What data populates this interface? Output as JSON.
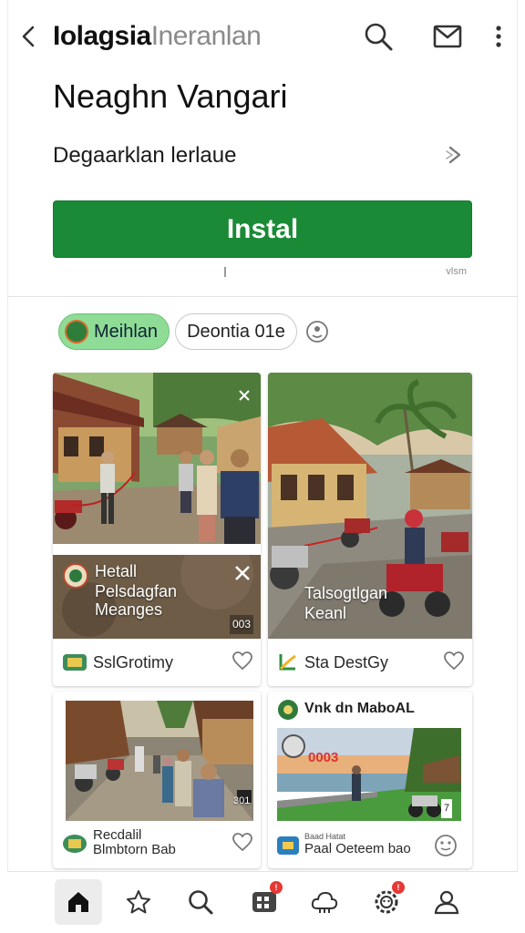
{
  "header": {
    "title_bold": "Iolagsia",
    "title_light": "Ineranlan",
    "back_icon": "chevron-left-icon",
    "search_icon": "search-icon",
    "mail_icon": "mail-icon",
    "more_icon": "more-vert-icon"
  },
  "app": {
    "name": "Neaghn Vangari",
    "subtitle": "Degaarklan lerlaue",
    "install_label": "Instal",
    "small_note": "vlsm",
    "accent": "#1a8a36"
  },
  "filters": {
    "active_chip": "Meihlan",
    "second_chip": "Deontia 01e"
  },
  "cards": [
    {
      "caption_lines": [
        "Hetall",
        "Pelsdagfan",
        "Meanges"
      ],
      "badge": "003",
      "footer_label": "SslGrotimy"
    },
    {
      "caption_lines": [
        "Talsogtlgan",
        "Keanl"
      ],
      "footer_label": "Sta DestGy"
    },
    {
      "badge": "301",
      "footer_lines": [
        "Recdalil",
        "Blmbtorn Bab"
      ]
    },
    {
      "title": "Vnk dn MaboAL",
      "image_text": "0003",
      "badge": "7",
      "footer_small": "Baad Hatat",
      "footer_label": "Paal Oeteem bao"
    }
  ],
  "nav": {
    "items": [
      "home-icon",
      "star-icon",
      "search-icon",
      "apps-icon",
      "cloud-icon",
      "settings-icon",
      "profile-icon"
    ],
    "apps_badge": "!",
    "settings_badge": "!"
  }
}
